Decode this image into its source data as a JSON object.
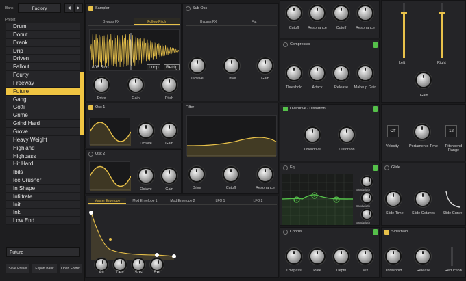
{
  "sidebar": {
    "bank_label": "Bank",
    "bank_value": "Factory",
    "prev_icon": "triangle-left-icon",
    "next_icon": "triangle-right-icon",
    "preset_label": "Preset",
    "presets": [
      "Drum",
      "Donut",
      "Drank",
      "Drip",
      "Driven",
      "Fallout",
      "Fourty",
      "Freeway",
      "Future",
      "Gang",
      "Gotti",
      "Grime",
      "Grind Hard",
      "Grove",
      "Heavy Weight",
      "Highland",
      "Highpass",
      "Hit Hard",
      "Ibils",
      "Ice Crusher",
      "In Shape",
      "Infiltrate",
      "Init",
      "Ink",
      "Low End"
    ],
    "selected_preset": "Future",
    "preset_name": "Future",
    "save_preset": "Save Preset",
    "export_bank": "Export Bank",
    "open_folder": "Open Folder"
  },
  "sampler": {
    "title": "Sampler",
    "tabs": [
      "Bypass FX",
      "Follow Pitch"
    ],
    "active_tab": "Follow Pitch",
    "sample_name": "808 Run",
    "loop": "Loop",
    "retrig": "Retrig",
    "knobs": [
      "Drive",
      "Gain",
      "Pitch"
    ]
  },
  "sub_osc": {
    "title": "Sub Osc",
    "tabs": [
      "Bypass FX",
      "Fat"
    ],
    "knobs": [
      "Octave",
      "Drive",
      "Gain"
    ]
  },
  "osc1": {
    "title": "Osc 1",
    "knobs": [
      "Octave",
      "Gain"
    ]
  },
  "osc2": {
    "title": "Osc 2",
    "knobs": [
      "Octave",
      "Gain"
    ]
  },
  "filter": {
    "title": "Filter",
    "knobs": [
      "Drive",
      "Cutoff",
      "Resonance"
    ]
  },
  "envelopes": {
    "tabs": [
      "Master Envelope",
      "Mod Envelope 1",
      "Mod Envelope 2",
      "LFO 1",
      "LFO 2"
    ],
    "active_tab": "Master Envelope",
    "labels": [
      "Att",
      "Dec",
      "Sus",
      "Rel"
    ]
  },
  "top_filters": {
    "knobs": [
      "Cutoff",
      "Resonance",
      "Cutoff",
      "Resonance"
    ]
  },
  "compressor": {
    "title": "Compressor",
    "knobs": [
      "Threshold",
      "Attack",
      "Release",
      "Makeup Gain"
    ]
  },
  "overdrive": {
    "title": "Overdrive / Distortion",
    "knobs": [
      "Overdrive",
      "Distortion"
    ]
  },
  "eq": {
    "title": "Eq",
    "bandwidth_labels": [
      "Bandwidth",
      "Bandwidth",
      "Bandwidth"
    ],
    "nodes": [
      "1",
      "2",
      "3"
    ]
  },
  "chorus": {
    "title": "Chorus",
    "knobs": [
      "Lowpass",
      "Rate",
      "Depth",
      "Mix"
    ]
  },
  "output": {
    "left": "Left",
    "right": "Right",
    "gain": "Gain"
  },
  "voice": {
    "velocity_value": "Off",
    "velocity_label": "Velocity",
    "portamento_label": "Portamento Time",
    "pitchbend_value": "12",
    "pitchbend_label": "Pitchbend Range"
  },
  "glide": {
    "title": "Glide",
    "knobs": [
      "Slide Time",
      "Slide Octaves"
    ],
    "curve_label": "Slide Curve"
  },
  "sidechain": {
    "title": "Sidechain",
    "knobs": [
      "Threshold",
      "Release"
    ],
    "reduction_label": "Reduction"
  },
  "colors": {
    "accent": "#e8c14a",
    "enabled": "#55c04a",
    "background": "#1b1b1d",
    "panel": "#242427"
  }
}
